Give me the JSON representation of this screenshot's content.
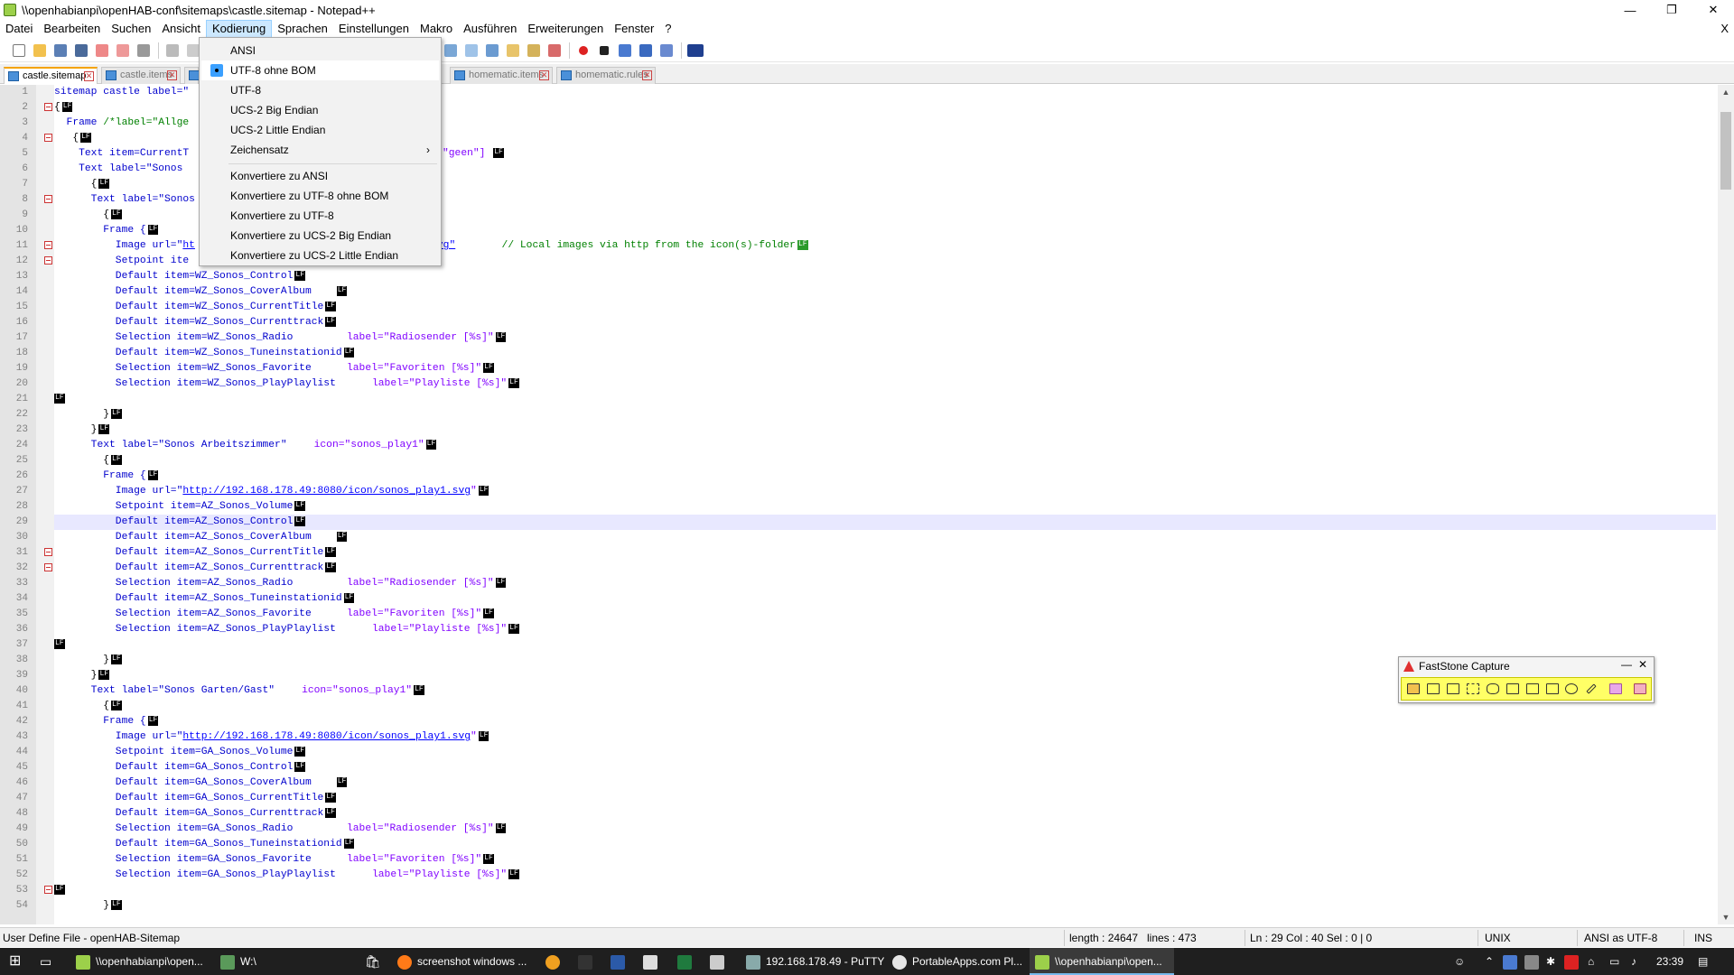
{
  "window": {
    "title": "\\\\openhabianpi\\openHAB-conf\\sitemaps\\castle.sitemap - Notepad++"
  },
  "menubar": {
    "items": [
      "Datei",
      "Bearbeiten",
      "Suchen",
      "Ansicht",
      "Kodierung",
      "Sprachen",
      "Einstellungen",
      "Makro",
      "Ausführen",
      "Erweiterungen",
      "Fenster",
      "?"
    ],
    "active": "Kodierung",
    "close": "X"
  },
  "tabs": [
    {
      "label": "castle.sitemap",
      "active": true
    },
    {
      "label": "castle.items",
      "active": false
    },
    {
      "label": "homematic.items",
      "active": false
    },
    {
      "label": "homematic.rules",
      "active": false
    }
  ],
  "encoding_menu": {
    "items": [
      "ANSI",
      "UTF-8 ohne BOM",
      "UTF-8",
      "UCS-2 Big Endian",
      "UCS-2 Little Endian",
      "Zeichensatz"
    ],
    "selected": "UTF-8 ohne BOM",
    "submenu_arrow": "›",
    "convert_items": [
      "Konvertiere zu ANSI",
      "Konvertiere zu UTF-8 ohne BOM",
      "Konvertiere zu UTF-8",
      "Konvertiere zu UCS-2 Big Endian",
      "Konvertiere zu UCS-2 Little Endian"
    ]
  },
  "editor": {
    "line_numbers": [
      "1",
      "2",
      "3",
      "4",
      "5",
      "6",
      "7",
      "8",
      "9",
      "10",
      "11",
      "12",
      "13",
      "14",
      "15",
      "16",
      "17",
      "18",
      "19",
      "20",
      "21",
      "22",
      "23",
      "24",
      "25",
      "26",
      "27",
      "28",
      "29",
      "30",
      "31",
      "32",
      "33",
      "34",
      "35",
      "36",
      "37",
      "38",
      "39",
      "40",
      "41",
      "42",
      "43",
      "44",
      "45",
      "46",
      "47",
      "48",
      "49",
      "50",
      "51",
      "52",
      "53",
      "54"
    ],
    "current_line": "29",
    "eol_marker": "LF",
    "code": {
      "l1": "sitemap castle label=\"",
      "l2": "{",
      "l3a": "  Frame ",
      "l3b": "/*label=\"Allge",
      "l4": "   {",
      "l5a": "    Text item=CurrentT",
      "l5b": "\"geen\"]",
      "l6": "    Text label=\"Sonos ",
      "l7": "      {",
      "l8": "      Text label=\"Sonos",
      "l9": "        {",
      "l10": "        Frame {",
      "l11a": "          Image url=\"",
      "l11b": "ht",
      "l11c": "ay3.svg\"",
      "l11d": "  // Local images via http from the icon(s)-folder",
      "l12": "          Setpoint ite",
      "l13": "          Default item=WZ_Sonos_Control",
      "l14": "          Default item=WZ_Sonos_CoverAlbum",
      "l15": "          Default item=WZ_Sonos_CurrentTitle",
      "l16": "          Default item=WZ_Sonos_Currenttrack",
      "l17a": "          Selection item=WZ_Sonos_Radio",
      "l17b": "label=\"Radiosender [%s]\"",
      "l18": "          Default item=WZ_Sonos_Tuneinstationid",
      "l19a": "          Selection item=WZ_Sonos_Favorite",
      "l19b": "label=\"Favoriten [%s]\"",
      "l20a": "          Selection item=WZ_Sonos_PlayPlaylist",
      "l20b": "label=\"Playliste [%s]\"",
      "l22": "        }",
      "l23": "      }",
      "l24a": "      Text label=\"Sonos Arbeitszimmer\"",
      "l24b": "icon=\"sonos_play1\"",
      "l25": "        {",
      "l26": "        Frame {",
      "l27a": "          Image url=\"",
      "l27b": "http://192.168.178.49:8080/icon/sonos_play1.svg",
      "l27c": "\"",
      "l28": "          Setpoint item=AZ_Sonos_Volume",
      "l29": "          Default item=AZ_Sonos_Control",
      "l30": "          Default item=AZ_Sonos_CoverAlbum",
      "l31": "          Default item=AZ_Sonos_CurrentTitle",
      "l32": "          Default item=AZ_Sonos_Currenttrack",
      "l33a": "          Selection item=AZ_Sonos_Radio",
      "l33b": "label=\"Radiosender [%s]\"",
      "l34": "          Default item=AZ_Sonos_Tuneinstationid",
      "l35a": "          Selection item=AZ_Sonos_Favorite",
      "l35b": "label=\"Favoriten [%s]\"",
      "l36a": "          Selection item=AZ_Sonos_PlayPlaylist",
      "l36b": "label=\"Playliste [%s]\"",
      "l38": "        }",
      "l39": "      }",
      "l40a": "      Text label=\"Sonos Garten/Gast\"",
      "l40b": "icon=\"sonos_play1\"",
      "l41": "        {",
      "l42": "        Frame {",
      "l43a": "          Image url=\"",
      "l43b": "http://192.168.178.49:8080/icon/sonos_play1.svg",
      "l43c": "\"",
      "l44": "          Setpoint item=GA_Sonos_Volume",
      "l45": "          Default item=GA_Sonos_Control",
      "l46": "          Default item=GA_Sonos_CoverAlbum",
      "l47": "          Default item=GA_Sonos_CurrentTitle",
      "l48": "          Default item=GA_Sonos_Currenttrack",
      "l49a": "          Selection item=GA_Sonos_Radio",
      "l49b": "label=\"Radiosender [%s]\"",
      "l50": "          Default item=GA_Sonos_Tuneinstationid",
      "l51a": "          Selection item=GA_Sonos_Favorite",
      "l51b": "label=\"Favoriten [%s]\"",
      "l52a": "          Selection item=GA_Sonos_PlayPlaylist",
      "l52b": "label=\"Playliste [%s]\"",
      "l54": "        }"
    }
  },
  "faststone": {
    "title": "FastStone Capture",
    "minimize": "—",
    "close": "✕"
  },
  "statusbar": {
    "filetype": "User Define File - openHAB-Sitemap",
    "length": "length : 24647",
    "lines": "lines : 473",
    "position": "Ln : 29    Col : 40    Sel : 0 | 0",
    "eol": "UNIX",
    "encoding": "ANSI as UTF-8",
    "mode": "INS"
  },
  "taskbar": {
    "items": [
      "\\\\openhabianpi\\open...",
      "W:\\",
      "screenshot windows ...",
      "192.168.178.49 - PuTTY",
      "PortableApps.com Pl...",
      "\\\\openhabianpi\\open..."
    ],
    "clock": "23:39"
  },
  "colors": {
    "accent": "#cce8ff",
    "tab_active": "#f4a300",
    "taskbar": "#1f1f1f"
  }
}
